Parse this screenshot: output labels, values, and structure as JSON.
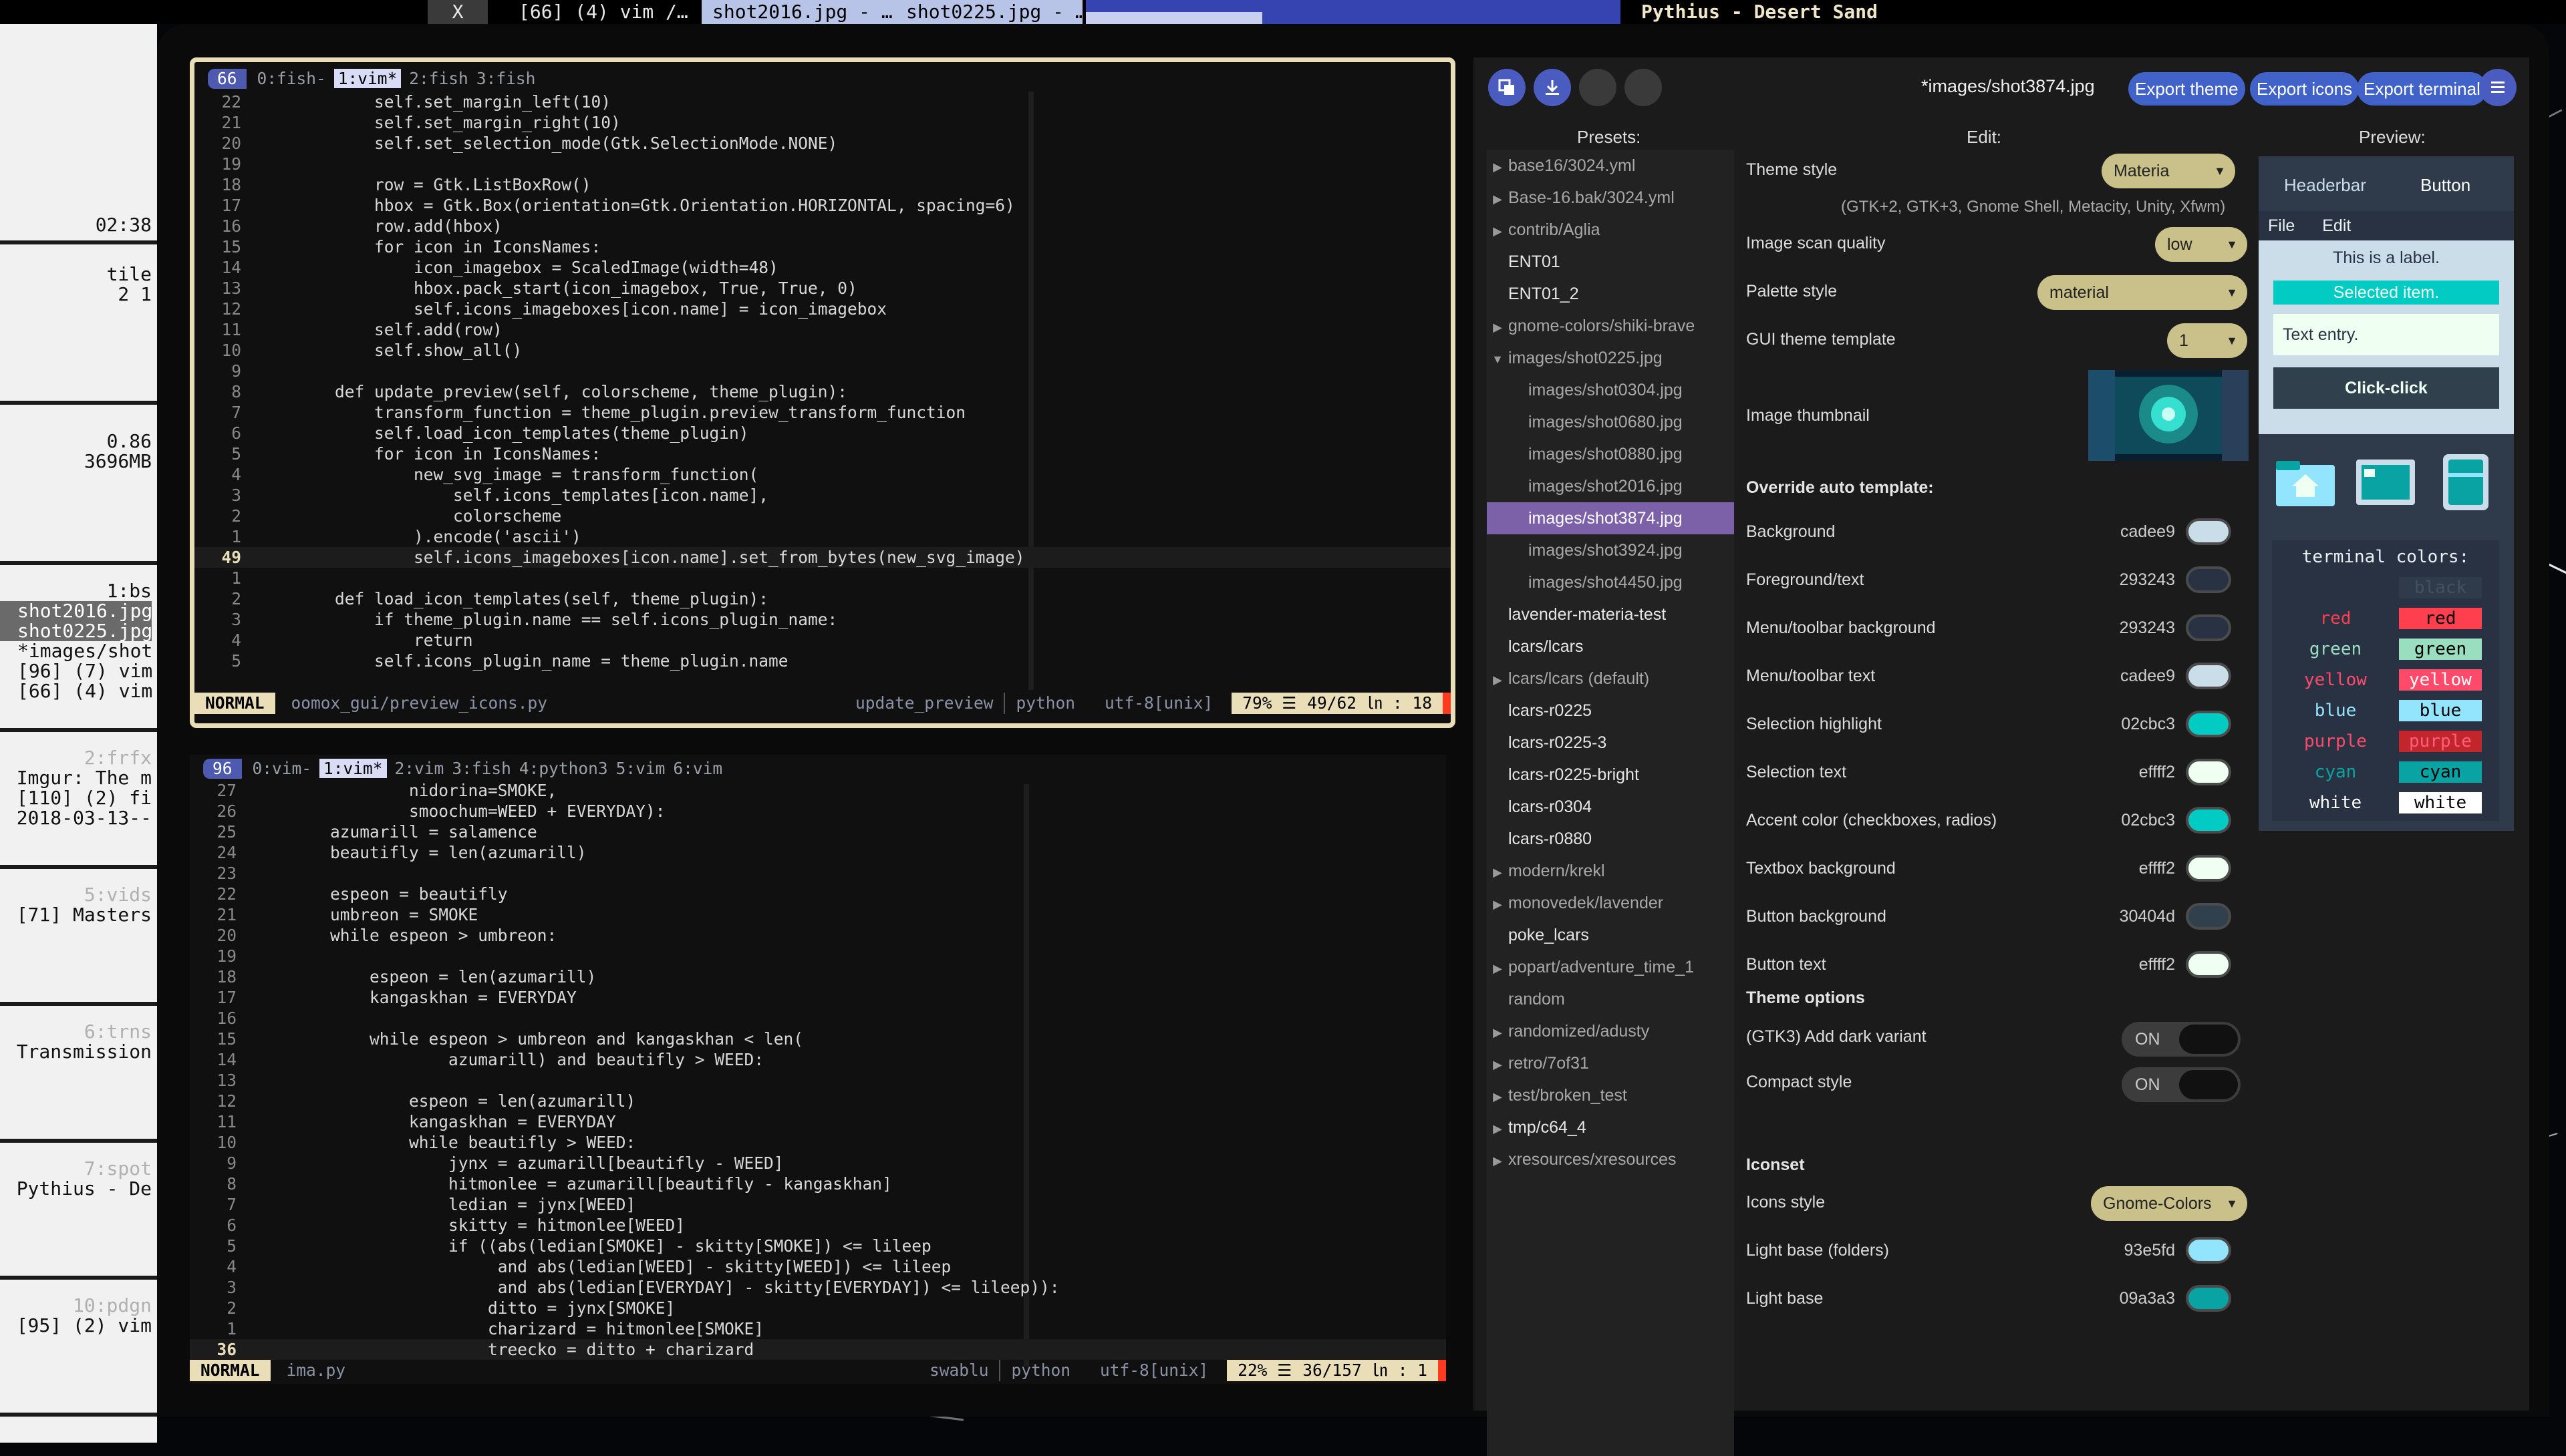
{
  "topbar": {
    "close_label": "X",
    "windows": [
      "[66] (4) vim",
      "/…",
      "shot2016.jpg - …",
      "shot0225.jpg - …"
    ],
    "progress_fraction": 0.33,
    "title": "Pythius - Desert Sand"
  },
  "leftpanel": {
    "clock": "02:38",
    "layout": "tile",
    "layout_counts": "2 1",
    "load": "0.86",
    "memory": "3696MB",
    "groups": [
      {
        "header": "1:bs",
        "lines": [
          "shot2016.jpg",
          "shot0225.jpg",
          "*images/shot",
          "[96] (7) vim",
          "[66] (4) vim"
        ]
      },
      {
        "header": "2:frfx",
        "lines": [
          "Imgur: The m",
          "[110] (2) fi",
          "2018-03-13--"
        ]
      },
      {
        "header": "5:vids",
        "lines": [
          "[71] Masters"
        ]
      },
      {
        "header": "6:trns",
        "lines": [
          "Transmission"
        ]
      },
      {
        "header": "7:spot",
        "lines": [
          "Pythius - De"
        ]
      },
      {
        "header": "10:pdgn",
        "lines": [
          "[95] (2) vim"
        ]
      }
    ]
  },
  "vim1": {
    "count": "66",
    "tabs": [
      "0:fish-",
      "1:vim*",
      "2:fish",
      "3:fish"
    ],
    "active_tab": 1,
    "lines": [
      {
        "n": "22",
        "t": "            self.set_margin_left(10)"
      },
      {
        "n": "21",
        "t": "            self.set_margin_right(10)"
      },
      {
        "n": "20",
        "t": "            self.set_selection_mode(Gtk.SelectionMode.NONE)"
      },
      {
        "n": "19",
        "t": ""
      },
      {
        "n": "18",
        "t": "            row = Gtk.ListBoxRow()"
      },
      {
        "n": "17",
        "t": "            hbox = Gtk.Box(orientation=Gtk.Orientation.HORIZONTAL, spacing=6)"
      },
      {
        "n": "16",
        "t": "            row.add(hbox)"
      },
      {
        "n": "15",
        "t": "            for icon in IconsNames:"
      },
      {
        "n": "14",
        "t": "                icon_imagebox = ScaledImage(width=48)"
      },
      {
        "n": "13",
        "t": "                hbox.pack_start(icon_imagebox, True, True, 0)"
      },
      {
        "n": "12",
        "t": "                self.icons_imageboxes[icon.name] = icon_imagebox"
      },
      {
        "n": "11",
        "t": "            self.add(row)"
      },
      {
        "n": "10",
        "t": "            self.show_all()"
      },
      {
        "n": "9",
        "t": ""
      },
      {
        "n": "8",
        "t": "        def update_preview(self, colorscheme, theme_plugin):"
      },
      {
        "n": "7",
        "t": "            transform_function = theme_plugin.preview_transform_function"
      },
      {
        "n": "6",
        "t": "            self.load_icon_templates(theme_plugin)"
      },
      {
        "n": "5",
        "t": "            for icon in IconsNames:"
      },
      {
        "n": "4",
        "t": "                new_svg_image = transform_function("
      },
      {
        "n": "3",
        "t": "                    self.icons_templates[icon.name],"
      },
      {
        "n": "2",
        "t": "                    colorscheme"
      },
      {
        "n": "1",
        "t": "                ).encode('ascii')"
      },
      {
        "n": "49",
        "t": "                self.icons_imageboxes[icon.name].set_from_bytes(new_svg_image)",
        "current": true
      },
      {
        "n": "1",
        "t": ""
      },
      {
        "n": "2",
        "t": "        def load_icon_templates(self, theme_plugin):"
      },
      {
        "n": "3",
        "t": "            if theme_plugin.name == self.icons_plugin_name:"
      },
      {
        "n": "4",
        "t": "                return"
      },
      {
        "n": "5",
        "t": "            self.icons_plugin_name = theme_plugin.name"
      }
    ],
    "status": {
      "mode": "NORMAL",
      "file": "oomox_gui/preview_icons.py",
      "function": "update_preview",
      "filetype": "python",
      "encoding": "utf-8[unix]",
      "percent": "79% ☰",
      "position": "49/62 ㏑ :  18"
    }
  },
  "vim2": {
    "count": "96",
    "tabs": [
      "0:vim-",
      "1:vim*",
      "2:vim",
      "3:fish",
      "4:python3",
      "5:vim",
      "6:vim"
    ],
    "active_tab": 1,
    "lines": [
      {
        "n": "27",
        "t": "                nidorina=SMOKE,"
      },
      {
        "n": "26",
        "t": "                smoochum=WEED + EVERYDAY):"
      },
      {
        "n": "25",
        "t": "        azumarill = salamence"
      },
      {
        "n": "24",
        "t": "        beautifly = len(azumarill)"
      },
      {
        "n": "23",
        "t": ""
      },
      {
        "n": "22",
        "t": "        espeon = beautifly"
      },
      {
        "n": "21",
        "t": "        umbreon = SMOKE"
      },
      {
        "n": "20",
        "t": "        while espeon > umbreon:"
      },
      {
        "n": "19",
        "t": ""
      },
      {
        "n": "18",
        "t": "            espeon = len(azumarill)"
      },
      {
        "n": "17",
        "t": "            kangaskhan = EVERYDAY"
      },
      {
        "n": "16",
        "t": ""
      },
      {
        "n": "15",
        "t": "            while espeon > umbreon and kangaskhan < len("
      },
      {
        "n": "14",
        "t": "                    azumarill) and beautifly > WEED:"
      },
      {
        "n": "13",
        "t": ""
      },
      {
        "n": "12",
        "t": "                espeon = len(azumarill)"
      },
      {
        "n": "11",
        "t": "                kangaskhan = EVERYDAY"
      },
      {
        "n": "10",
        "t": "                while beautifly > WEED:"
      },
      {
        "n": "9",
        "t": "                    jynx = azumarill[beautifly - WEED]"
      },
      {
        "n": "8",
        "t": "                    hitmonlee = azumarill[beautifly - kangaskhan]"
      },
      {
        "n": "7",
        "t": "                    ledian = jynx[WEED]"
      },
      {
        "n": "6",
        "t": "                    skitty = hitmonlee[WEED]"
      },
      {
        "n": "5",
        "t": "                    if ((abs(ledian[SMOKE] - skitty[SMOKE]) <= lileep"
      },
      {
        "n": "4",
        "t": "                         and abs(ledian[WEED] - skitty[WEED]) <= lileep"
      },
      {
        "n": "3",
        "t": "                         and abs(ledian[EVERYDAY] - skitty[EVERYDAY]) <= lileep)):"
      },
      {
        "n": "2",
        "t": "                        ditto = jynx[SMOKE]"
      },
      {
        "n": "1",
        "t": "                        charizard = hitmonlee[SMOKE]"
      },
      {
        "n": "36",
        "t": "                        treecko = ditto + charizard",
        "current": true
      }
    ],
    "status": {
      "mode": "NORMAL",
      "file": "ima.py",
      "function": "swablu",
      "filetype": "python",
      "encoding": "utf-8[unix]",
      "percent": "22% ☰",
      "position": "36/157 ㏑ :  1"
    }
  },
  "oomox": {
    "title": "*images/shot3874.jpg",
    "buttons": [
      "Export theme",
      "Export icons",
      "Export terminal"
    ],
    "menu_icon": "hamburger-icon",
    "col_presets": "Presets:",
    "col_edit": "Edit:",
    "col_preview": "Preview:",
    "presets": [
      {
        "label": "base16/3024.yml",
        "arrow": true
      },
      {
        "label": "Base-16.bak/3024.yml",
        "arrow": true
      },
      {
        "label": "contrib/Aglia",
        "arrow": true
      },
      {
        "label": "ENT01",
        "bright": true
      },
      {
        "label": "ENT01_2",
        "bright": true
      },
      {
        "label": "gnome-colors/shiki-brave",
        "arrow": true
      },
      {
        "label": "images/shot0225.jpg",
        "arrow": true,
        "open": true
      },
      {
        "label": "images/shot0304.jpg",
        "sub": true
      },
      {
        "label": "images/shot0680.jpg",
        "sub": true
      },
      {
        "label": "images/shot0880.jpg",
        "sub": true
      },
      {
        "label": "images/shot2016.jpg",
        "sub": true
      },
      {
        "label": "images/shot3874.jpg",
        "sub": true,
        "selected": true
      },
      {
        "label": "images/shot3924.jpg",
        "sub": true
      },
      {
        "label": "images/shot4450.jpg",
        "sub": true
      },
      {
        "label": "lavender-materia-test",
        "bright": true
      },
      {
        "label": "lcars/lcars",
        "bright": true
      },
      {
        "label": "lcars/lcars (default)",
        "arrow": true
      },
      {
        "label": "lcars-r0225",
        "bright": true
      },
      {
        "label": "lcars-r0225-3",
        "bright": true
      },
      {
        "label": "lcars-r0225-bright",
        "bright": true
      },
      {
        "label": "lcars-r0304",
        "bright": true
      },
      {
        "label": "lcars-r0880",
        "bright": true
      },
      {
        "label": "modern/krekl",
        "arrow": true
      },
      {
        "label": "monovedek/lavender",
        "arrow": true
      },
      {
        "label": "poke_lcars",
        "bright": true
      },
      {
        "label": "popart/adventure_time_1",
        "arrow": true
      },
      {
        "label": "random"
      },
      {
        "label": "randomized/adusty",
        "arrow": true
      },
      {
        "label": "retro/7of31",
        "arrow": true
      },
      {
        "label": "test/broken_test",
        "arrow": true
      },
      {
        "label": "tmp/c64_4",
        "arrow": true,
        "bright": true
      },
      {
        "label": "xresources/xresources",
        "arrow": true
      }
    ],
    "theme_style": {
      "label": "Theme style",
      "value": "Materia",
      "note": "(GTK+2, GTK+3, Gnome Shell, Metacity, Unity, Xfwm)"
    },
    "scan_quality": {
      "label": "Image scan quality",
      "value": "low"
    },
    "palette_style": {
      "label": "Palette style",
      "value": "material"
    },
    "gui_template": {
      "label": "GUI theme template",
      "value": "1"
    },
    "thumbnail_label": "Image thumbnail",
    "override_heading": "Override auto template:",
    "colors": [
      {
        "label": "Background",
        "hex": "cadee9",
        "color": "#cadee9"
      },
      {
        "label": "Foreground/text",
        "hex": "293243",
        "color": "#293243"
      },
      {
        "label": "Menu/toolbar background",
        "hex": "293243",
        "color": "#293243"
      },
      {
        "label": "Menu/toolbar text",
        "hex": "cadee9",
        "color": "#cadee9"
      },
      {
        "label": "Selection highlight",
        "hex": "02cbc3",
        "color": "#02cbc3"
      },
      {
        "label": "Selection text",
        "hex": "effff2",
        "color": "#effff2"
      },
      {
        "label": "Accent color (checkboxes, radios)",
        "hex": "02cbc3",
        "color": "#02cbc3"
      },
      {
        "label": "Textbox background",
        "hex": "effff2",
        "color": "#effff2"
      },
      {
        "label": "Button background",
        "hex": "30404d",
        "color": "#30404d"
      },
      {
        "label": "Button text",
        "hex": "effff2",
        "color": "#effff2"
      }
    ],
    "theme_options_heading": "Theme options",
    "options": [
      {
        "label": "(GTK3) Add dark variant",
        "state": "ON"
      },
      {
        "label": "Compact style",
        "state": "ON"
      }
    ],
    "iconset_heading": "Iconset",
    "icons_style": {
      "label": "Icons style",
      "value": "Gnome-Colors"
    },
    "icon_colors": [
      {
        "label": "Light base (folders)",
        "hex": "93e5fd",
        "color": "#93e5fd"
      },
      {
        "label": "Light base",
        "hex": "09a3a3",
        "color": "#09a3a3"
      }
    ],
    "preview": {
      "headerbar": "Headerbar",
      "button": "Button",
      "menu_file": "File",
      "menu_edit": "Edit",
      "label": "This is a label.",
      "selected": "Selected item.",
      "entry": "Text entry.",
      "click": "Click-click",
      "terminal_title": "terminal colors:",
      "terminal": [
        {
          "name": "black",
          "bg": "#2f3b4a",
          "fg": "#44505e",
          "bfg": "#44505e"
        },
        {
          "name": "red",
          "bg": "#ff3e4e",
          "fg": "#ff3e4e",
          "bfg": "#000000"
        },
        {
          "name": "green",
          "bg": "#9adec0",
          "fg": "#9adec0",
          "bfg": "#000000"
        },
        {
          "name": "yellow",
          "bg": "#ff4a6a",
          "fg": "#ff4a6a",
          "bfg": "#ffffff"
        },
        {
          "name": "blue",
          "bg": "#93e5fd",
          "fg": "#93e5fd",
          "bfg": "#000000"
        },
        {
          "name": "purple",
          "bg": "#c2262c",
          "fg": "#ff4a6a",
          "bfg": "#ff5f7a"
        },
        {
          "name": "cyan",
          "bg": "#09a3a3",
          "fg": "#09a3a3",
          "bfg": "#000000"
        },
        {
          "name": "white",
          "bg": "#ffffff",
          "fg": "#ffffff",
          "bfg": "#000000"
        }
      ]
    }
  }
}
